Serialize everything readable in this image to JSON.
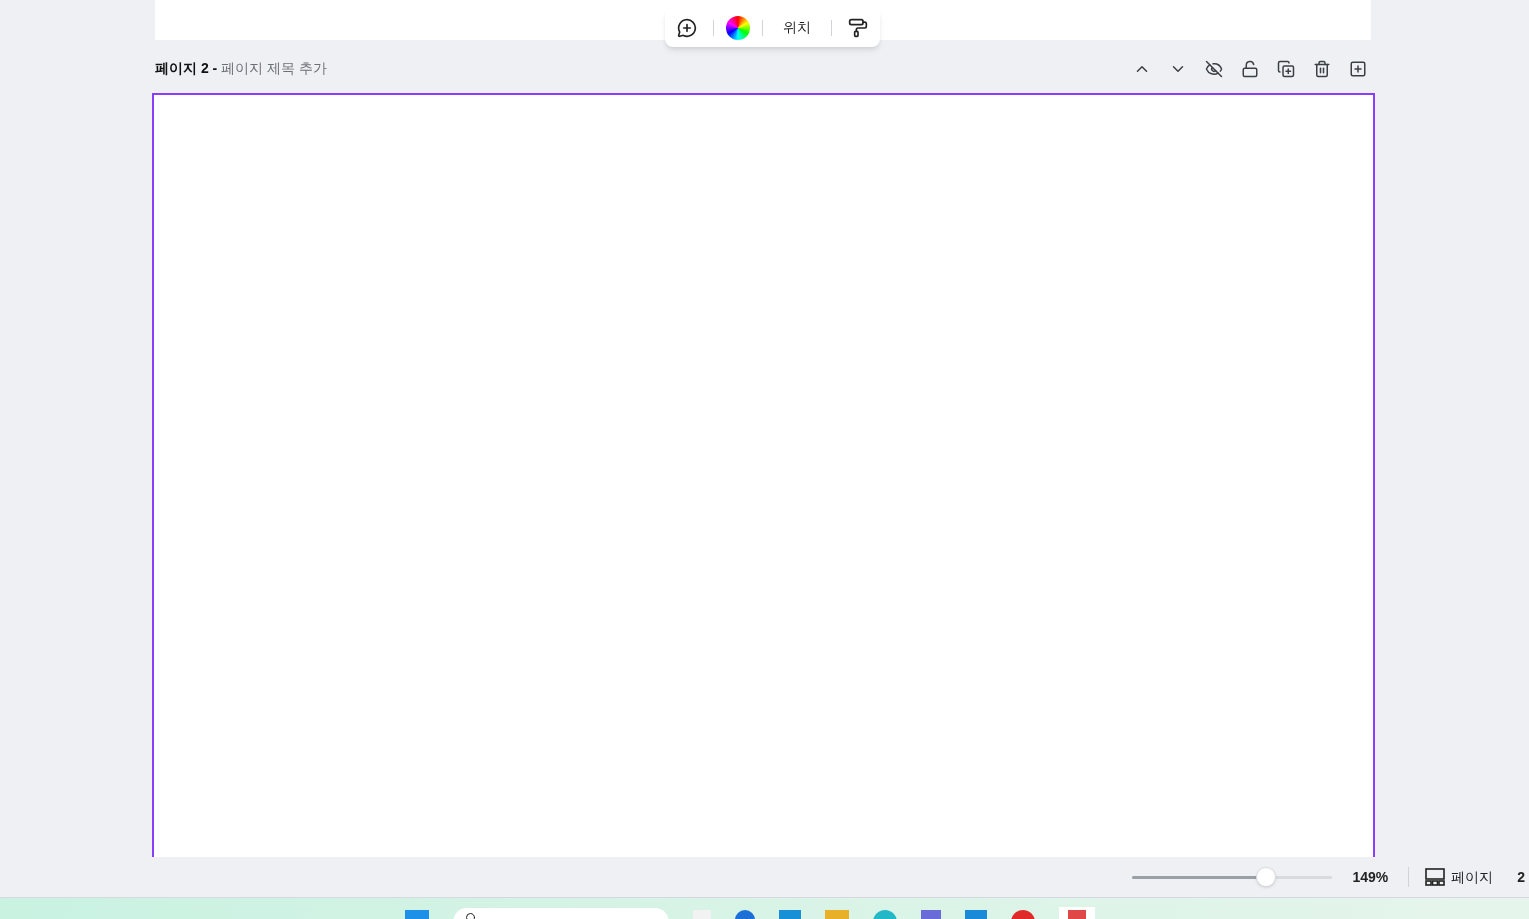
{
  "toolbar": {
    "position_label": "위치"
  },
  "page": {
    "number_label": "페이지 2 -",
    "title_placeholder": "페이지 제목 추가",
    "selected": true
  },
  "status_bar": {
    "zoom": {
      "level": 0.67,
      "reading": "149%"
    },
    "pages_label": "페이지",
    "page_count": "2"
  }
}
